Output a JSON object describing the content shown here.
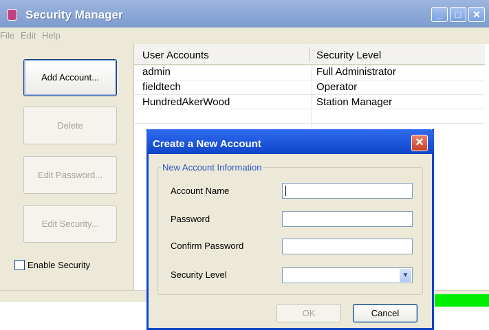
{
  "window": {
    "title": "Security Manager",
    "menu": [
      "File",
      "Edit",
      "Help"
    ],
    "buttons": {
      "add": "Add Account...",
      "delete": "Delete",
      "edit_password": "Edit Password...",
      "edit_security": "Edit Security..."
    },
    "enable_security": {
      "label": "Enable Security",
      "checked": false
    }
  },
  "table": {
    "columns": [
      "User Accounts",
      "Security Level"
    ],
    "rows": [
      {
        "user": "admin",
        "level": "Full Administrator"
      },
      {
        "user": "fieldtech",
        "level": "Operator"
      },
      {
        "user": "HundredAkerWood",
        "level": "Station Manager"
      }
    ]
  },
  "dialog": {
    "title": "Create a New Account",
    "group_label": "New Account Information",
    "fields": [
      {
        "label": "Account Name",
        "value": ""
      },
      {
        "label": "Password",
        "value": ""
      },
      {
        "label": "Confirm Password",
        "value": ""
      },
      {
        "label": "Security Level",
        "value": ""
      }
    ],
    "ok": "OK",
    "cancel": "Cancel"
  },
  "colors": {
    "titlebar": "#7d9bcf",
    "dialog_title": "#0f45c8",
    "status_green": "#00ee00"
  }
}
